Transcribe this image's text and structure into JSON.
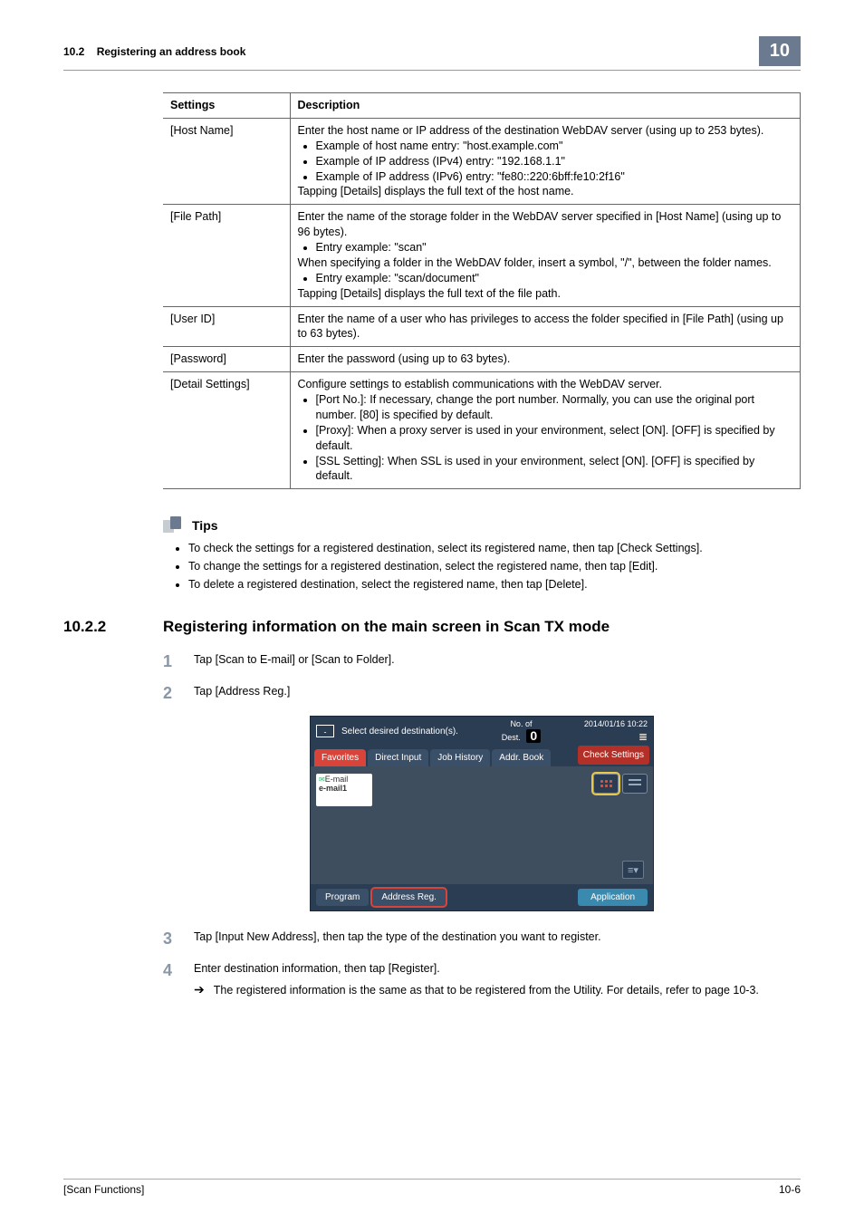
{
  "header": {
    "section_no": "10.2",
    "section_title": "Registering an address book",
    "chapter_no": "10"
  },
  "table": {
    "col_settings": "Settings",
    "col_description": "Description",
    "rows": [
      {
        "setting": "[Host Name]",
        "desc_pre": "Enter the host name or IP address of the destination WebDAV server (using up to 253 bytes).",
        "bullets": [
          "Example of host name entry: \"host.example.com\"",
          "Example of IP address (IPv4) entry: \"192.168.1.1\"",
          "Example of IP address (IPv6) entry: \"fe80::220:6bff:fe10:2f16\""
        ],
        "desc_post": "Tapping [Details] displays the full text of the host name."
      },
      {
        "setting": "[File Path]",
        "desc_pre": "Enter the name of the storage folder in the WebDAV server specified in [Host Name] (using up to 96 bytes).",
        "bullets": [
          "Entry example: \"scan\""
        ],
        "mid": "When specifying a folder in the WebDAV folder, insert a symbol, \"/\", between the folder names.",
        "bullets2": [
          "Entry example: \"scan/document\""
        ],
        "desc_post": "Tapping [Details] displays the full text of the file path."
      },
      {
        "setting": "[User ID]",
        "desc_pre": "Enter the name of a user who has privileges to access the folder specified in [File Path] (using up to 63 bytes)."
      },
      {
        "setting": "[Password]",
        "desc_pre": "Enter the password (using up to 63 bytes)."
      },
      {
        "setting": "[Detail Settings]",
        "desc_pre": "Configure settings to establish communications with the WebDAV server.",
        "bullets": [
          "[Port No.]: If necessary, change the port number. Normally, you can use the original port number. [80] is specified by default.",
          "[Proxy]: When a proxy server is used in your environment, select [ON]. [OFF] is specified by default.",
          "[SSL Setting]: When SSL is used in your environment, select [ON]. [OFF] is specified by default."
        ]
      }
    ]
  },
  "tips": {
    "label": "Tips",
    "items": [
      "To check the settings for a registered destination, select its registered name, then tap [Check Settings].",
      "To change the settings for a registered destination, select the registered name, then tap [Edit].",
      "To delete a registered destination, select the registered name, then tap [Delete]."
    ]
  },
  "subsection": {
    "num": "10.2.2",
    "title": "Registering information on the main screen in Scan TX mode"
  },
  "steps": [
    {
      "n": "1",
      "text": "Tap [Scan to E-mail] or [Scan to Folder]."
    },
    {
      "n": "2",
      "text": "Tap [Address Reg.]"
    },
    {
      "n": "3",
      "text": "Tap [Input New Address], then tap the type of the destination you want to register."
    },
    {
      "n": "4",
      "text": "Enter destination information, then tap [Register].",
      "sub": "The registered information is the same as that to be registered from the Utility. For details, refer to page 10-3."
    }
  ],
  "screenshot": {
    "prompt": "Select desired destination(s).",
    "dest_label": "No. of\nDest.",
    "dest_count": "0",
    "datetime": "2014/01/16 10:22",
    "tabs": {
      "favorites": "Favorites",
      "direct_input": "Direct Input",
      "job_history": "Job History",
      "addr_book": "Addr. Book"
    },
    "check_settings": "Check Settings",
    "email_card_tag": "E-mail",
    "email_card_name": "e-mail1",
    "bottom": {
      "program": "Program",
      "address_reg": "Address Reg.",
      "application": "Application"
    }
  },
  "footer": {
    "left": "[Scan Functions]",
    "right": "10-6"
  }
}
